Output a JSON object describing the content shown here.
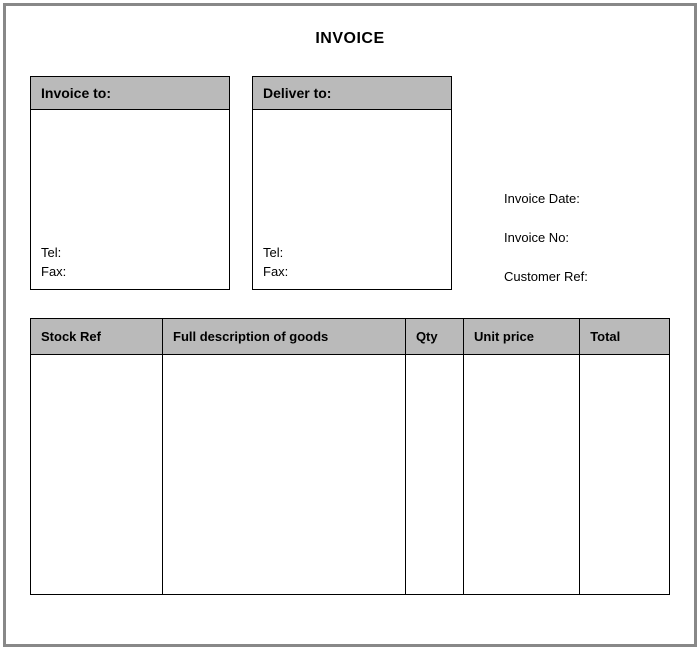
{
  "title": "INVOICE",
  "invoice_to": {
    "header": "Invoice to:",
    "tel_label": "Tel:",
    "tel_value": "",
    "fax_label": "Fax:",
    "fax_value": ""
  },
  "deliver_to": {
    "header": "Deliver to:",
    "tel_label": "Tel:",
    "tel_value": "",
    "fax_label": "Fax:",
    "fax_value": ""
  },
  "meta": {
    "invoice_date_label": "Invoice Date:",
    "invoice_date_value": "",
    "invoice_no_label": "Invoice No:",
    "invoice_no_value": "",
    "customer_ref_label": "Customer Ref:",
    "customer_ref_value": ""
  },
  "columns": {
    "stock_ref": "Stock Ref",
    "description": "Full description of goods",
    "qty": "Qty",
    "unit_price": "Unit price",
    "total": "Total"
  },
  "rows": [
    {
      "stock_ref": "",
      "description": "",
      "qty": "",
      "unit_price": "",
      "total": ""
    }
  ]
}
